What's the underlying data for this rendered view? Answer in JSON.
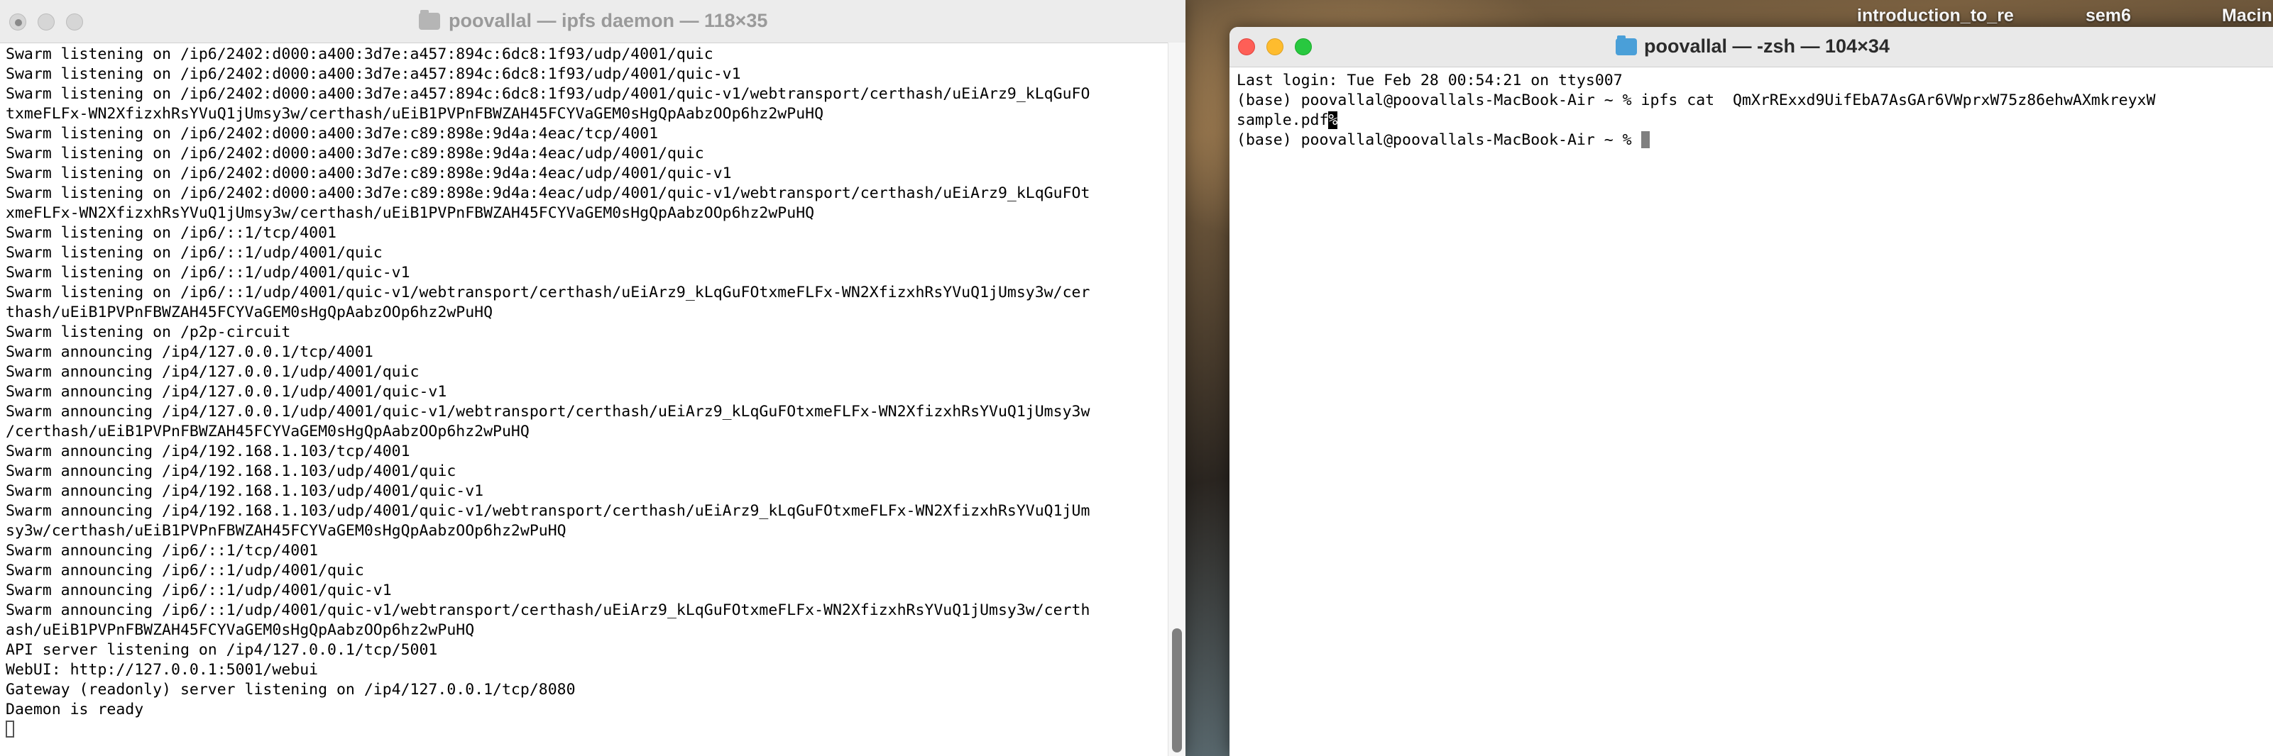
{
  "desktop": {
    "items": [
      "introduction_to_re",
      "sem6",
      "Macin"
    ]
  },
  "left_window": {
    "title": "poovallal — ipfs daemon — 118×35",
    "icon": "folder-icon",
    "lines": [
      "Swarm listening on /ip6/2402:d000:a400:3d7e:a457:894c:6dc8:1f93/udp/4001/quic",
      "Swarm listening on /ip6/2402:d000:a400:3d7e:a457:894c:6dc8:1f93/udp/4001/quic-v1",
      "Swarm listening on /ip6/2402:d000:a400:3d7e:a457:894c:6dc8:1f93/udp/4001/quic-v1/webtransport/certhash/uEiArz9_kLqGuFO",
      "txmeFLFx-WN2XfizxhRsYVuQ1jUmsy3w/certhash/uEiB1PVPnFBWZAH45FCYVaGEM0sHgQpAabzOOp6hz2wPuHQ",
      "Swarm listening on /ip6/2402:d000:a400:3d7e:c89:898e:9d4a:4eac/tcp/4001",
      "Swarm listening on /ip6/2402:d000:a400:3d7e:c89:898e:9d4a:4eac/udp/4001/quic",
      "Swarm listening on /ip6/2402:d000:a400:3d7e:c89:898e:9d4a:4eac/udp/4001/quic-v1",
      "Swarm listening on /ip6/2402:d000:a400:3d7e:c89:898e:9d4a:4eac/udp/4001/quic-v1/webtransport/certhash/uEiArz9_kLqGuFOt",
      "xmeFLFx-WN2XfizxhRsYVuQ1jUmsy3w/certhash/uEiB1PVPnFBWZAH45FCYVaGEM0sHgQpAabzOOp6hz2wPuHQ",
      "Swarm listening on /ip6/::1/tcp/4001",
      "Swarm listening on /ip6/::1/udp/4001/quic",
      "Swarm listening on /ip6/::1/udp/4001/quic-v1",
      "Swarm listening on /ip6/::1/udp/4001/quic-v1/webtransport/certhash/uEiArz9_kLqGuFOtxmeFLFx-WN2XfizxhRsYVuQ1jUmsy3w/cer",
      "thash/uEiB1PVPnFBWZAH45FCYVaGEM0sHgQpAabzOOp6hz2wPuHQ",
      "Swarm listening on /p2p-circuit",
      "Swarm announcing /ip4/127.0.0.1/tcp/4001",
      "Swarm announcing /ip4/127.0.0.1/udp/4001/quic",
      "Swarm announcing /ip4/127.0.0.1/udp/4001/quic-v1",
      "Swarm announcing /ip4/127.0.0.1/udp/4001/quic-v1/webtransport/certhash/uEiArz9_kLqGuFOtxmeFLFx-WN2XfizxhRsYVuQ1jUmsy3w",
      "/certhash/uEiB1PVPnFBWZAH45FCYVaGEM0sHgQpAabzOOp6hz2wPuHQ",
      "Swarm announcing /ip4/192.168.1.103/tcp/4001",
      "Swarm announcing /ip4/192.168.1.103/udp/4001/quic",
      "Swarm announcing /ip4/192.168.1.103/udp/4001/quic-v1",
      "Swarm announcing /ip4/192.168.1.103/udp/4001/quic-v1/webtransport/certhash/uEiArz9_kLqGuFOtxmeFLFx-WN2XfizxhRsYVuQ1jUm",
      "sy3w/certhash/uEiB1PVPnFBWZAH45FCYVaGEM0sHgQpAabzOOp6hz2wPuHQ",
      "Swarm announcing /ip6/::1/tcp/4001",
      "Swarm announcing /ip6/::1/udp/4001/quic",
      "Swarm announcing /ip6/::1/udp/4001/quic-v1",
      "Swarm announcing /ip6/::1/udp/4001/quic-v1/webtransport/certhash/uEiArz9_kLqGuFOtxmeFLFx-WN2XfizxhRsYVuQ1jUmsy3w/certh",
      "ash/uEiB1PVPnFBWZAH45FCYVaGEM0sHgQpAabzOOp6hz2wPuHQ",
      "API server listening on /ip4/127.0.0.1/tcp/5001",
      "WebUI: http://127.0.0.1:5001/webui",
      "Gateway (readonly) server listening on /ip4/127.0.0.1/tcp/8080",
      "Daemon is ready"
    ]
  },
  "right_window": {
    "title": "poovallal — -zsh — 104×34",
    "icon": "folder-icon",
    "line1": "Last login: Tue Feb 28 00:54:21 on ttys007",
    "line2": "(base) poovallal@poovallals-MacBook-Air ~ % ipfs cat  QmXrRExxd9UifEbA7AsGAr6VWprxW75z86ehwAXmkreyxW",
    "line3_text": "sample.pdf",
    "line3_mark": "%",
    "line4": "(base) poovallal@poovallals-MacBook-Air ~ % "
  },
  "colors": {
    "close": "#fe5f57",
    "minimize": "#febc2e",
    "maximize": "#28c840",
    "folder_blue": "#4a9fd8"
  }
}
